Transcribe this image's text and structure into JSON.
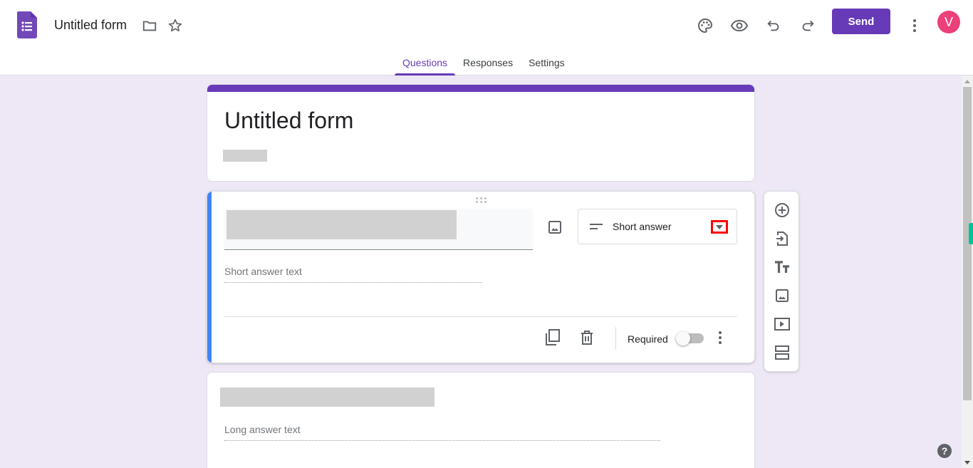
{
  "app": {
    "doc_title": "Untitled form",
    "icons": [
      "forms-logo-icon",
      "folder-icon",
      "star-icon"
    ]
  },
  "toolbar": {
    "icons": [
      "palette-icon",
      "preview-eye-icon",
      "undo-icon",
      "redo-icon"
    ],
    "send_label": "Send",
    "more_icon": "more-vert-icon",
    "avatar_initial": "V"
  },
  "tabs": [
    {
      "label": "Questions",
      "active": true
    },
    {
      "label": "Responses",
      "active": false
    },
    {
      "label": "Settings",
      "active": false
    }
  ],
  "form": {
    "title": "Untitled form",
    "description_redacted": true
  },
  "questions": [
    {
      "title_redacted": true,
      "type_label": "Short answer",
      "answer_hint": "Short answer text",
      "required_label": "Required",
      "required": false,
      "active": true
    },
    {
      "title_redacted": true,
      "answer_hint": "Long answer text"
    }
  ],
  "side_toolbar": [
    "add-question-icon",
    "import-questions-icon",
    "add-title-icon",
    "add-image-icon",
    "add-video-icon",
    "add-section-icon"
  ],
  "help_label": "?",
  "colors": {
    "brand": "#673ab7",
    "background": "#ede7f6",
    "active_question": "#4285f4",
    "avatar": "#ec407a",
    "highlight": "#ff0000"
  }
}
